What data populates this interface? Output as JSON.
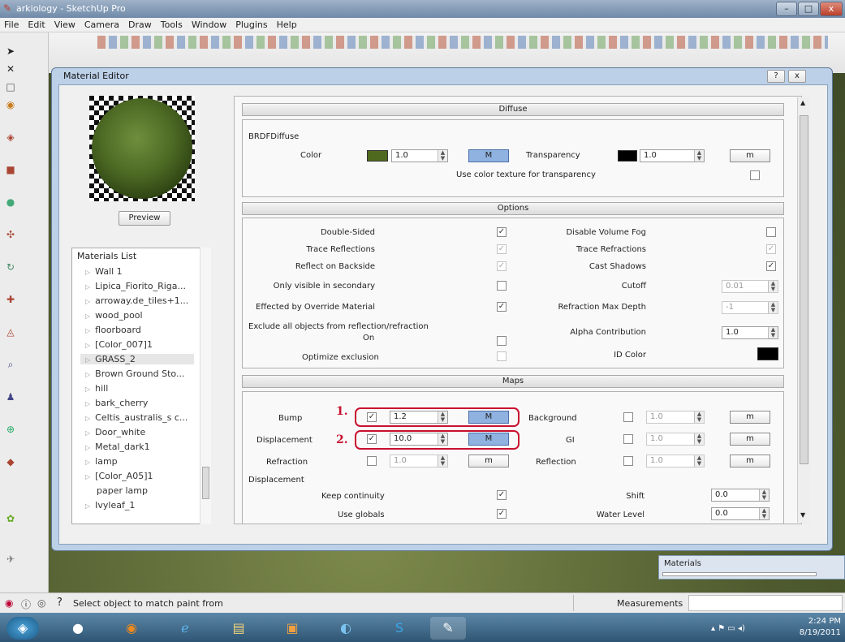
{
  "window": {
    "title": "arkiology - SketchUp Pro",
    "btn_min": "–",
    "btn_max": "□",
    "btn_close": "x"
  },
  "menu": [
    "File",
    "Edit",
    "View",
    "Camera",
    "Draw",
    "Tools",
    "Window",
    "Plugins",
    "Help"
  ],
  "dialog": {
    "title": "Material Editor",
    "help": "?",
    "close": "x",
    "preview_button": "Preview",
    "materials_list": {
      "header": "Materials List",
      "items": [
        "Wall 1",
        "Lipica_Fiorito_Riga...",
        "arroway.de_tiles+1...",
        "wood_pool",
        "floorboard",
        "[Color_007]1",
        "GRASS_2",
        "Brown Ground Sto...",
        "hill",
        "bark_cherry",
        "Celtis_australis_s c...",
        "Door_white",
        "Metal_dark1",
        "lamp",
        "[Color_A05]1",
        "paper lamp",
        "Ivyleaf_1"
      ],
      "selected": "GRASS_2"
    },
    "diffuse": {
      "section": "Diffuse",
      "group": "BRDFDiffuse",
      "color_label": "Color",
      "color_value": "1.0",
      "color_swatch": "#4f6a1e",
      "m_button": "M",
      "transparency_label": "Transparency",
      "transparency_value": "1.0",
      "transparency_swatch": "#000000",
      "m_small": "m",
      "use_texture_label": "Use color texture for transparency"
    },
    "options": {
      "section": "Options",
      "left": [
        {
          "label": "Double-Sided",
          "checked": true
        },
        {
          "label": "Trace Reflections",
          "checked": true
        },
        {
          "label": "Reflect on Backside",
          "checked": true
        },
        {
          "label": "Only visible in secondary",
          "checked": false
        },
        {
          "label": "Effected by Override Material",
          "checked": true
        }
      ],
      "exclude_label_1": "Exclude all objects from reflection/refraction",
      "exclude_label_2": "On",
      "optimize_label": "Optimize exclusion",
      "right": [
        {
          "label": "Disable Volume Fog",
          "checked": false
        },
        {
          "label": "Trace Refractions",
          "checked": true
        },
        {
          "label": "Cast Shadows",
          "checked": true
        }
      ],
      "cutoff_label": "Cutoff",
      "cutoff_value": "0.01",
      "refraction_max_label": "Refraction Max Depth",
      "refraction_max_value": "-1",
      "alpha_label": "Alpha Contribution",
      "alpha_value": "1.0",
      "id_color_label": "ID Color",
      "id_color_swatch": "#000000"
    },
    "maps": {
      "section": "Maps",
      "bump_label": "Bump",
      "bump_value": "1.2",
      "displacement_label": "Displacement",
      "displacement_value": "10.0",
      "refraction_label": "Refraction",
      "refraction_value": "1.0",
      "background_label": "Background",
      "background_value": "1.0",
      "gi_label": "GI",
      "gi_value": "1.0",
      "reflection_label": "Reflection",
      "reflection_value": "1.0",
      "m_button": "M",
      "m_small": "m",
      "displacement_group": "Displacement",
      "keep_continuity_label": "Keep continuity",
      "use_globals_label": "Use globals",
      "shift_label": "Shift",
      "shift_value": "0.0",
      "water_level_label": "Water Level",
      "water_level_value": "0.0",
      "annotation_1": "1.",
      "annotation_2": "2."
    }
  },
  "materials_panel": {
    "title": "Materials"
  },
  "status": {
    "message": "Select object to match paint from",
    "measurements": "Measurements"
  },
  "taskbar": {
    "time": "2:24 PM",
    "date": "8/19/2011"
  }
}
